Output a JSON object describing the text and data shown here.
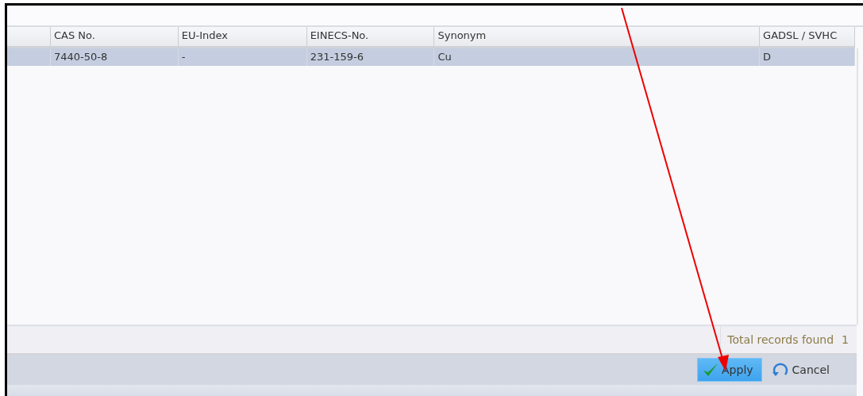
{
  "table": {
    "columns": [
      "",
      "CAS No.",
      "EU-Index",
      "EINECS-No.",
      "Synonym",
      "GADSL / SVHC"
    ],
    "rows": [
      {
        "cells": [
          "",
          "7440-50-8",
          "-",
          "231-159-6",
          "Cu",
          "D"
        ],
        "selected": true
      }
    ]
  },
  "footer": {
    "label": "Total records found",
    "count": "1"
  },
  "buttons": [
    {
      "label": "Apply",
      "kind": "apply"
    },
    {
      "label": "Cancel",
      "kind": "cancel"
    }
  ]
}
